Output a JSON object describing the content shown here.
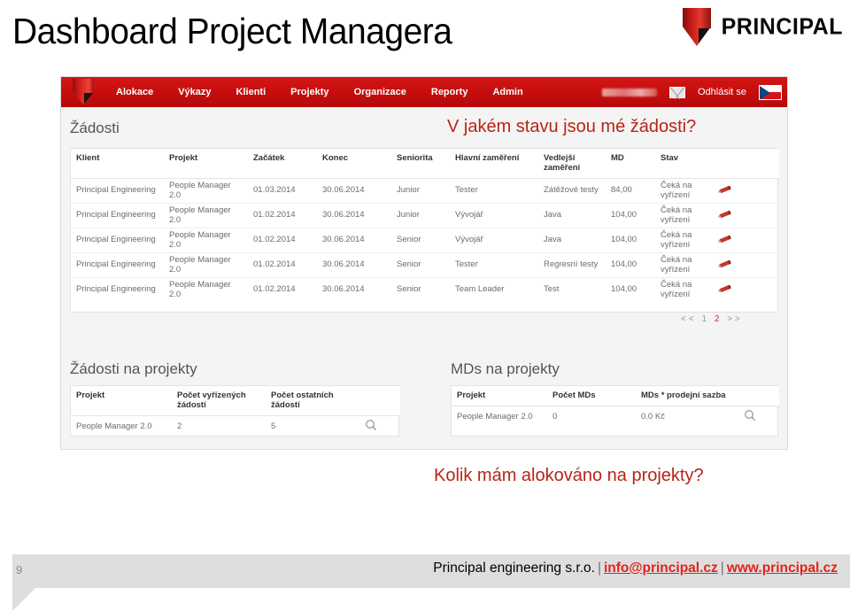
{
  "slide": {
    "title": "Dashboard Project Managera",
    "number": "9"
  },
  "brand": {
    "logo_word": "PRINCIPAL",
    "logo_icon": "principal-pennant-icon",
    "accent_red": "#c40d0d",
    "callout_red": "#b82418",
    "link_red": "#e2231a"
  },
  "app": {
    "navbar": {
      "logo_icon": "principal-pennant-icon",
      "items": [
        {
          "label": "Alokace"
        },
        {
          "label": "Výkazy"
        },
        {
          "label": "Klienti"
        },
        {
          "label": "Projekty"
        },
        {
          "label": "Organizace"
        },
        {
          "label": "Reporty"
        },
        {
          "label": "Admin"
        }
      ],
      "user_name": "",
      "mail_icon": "envelope-icon",
      "logout_label": "Odhlásit se",
      "flag_icon": "czech-flag-icon"
    },
    "requests": {
      "heading": "Žádosti",
      "columns": [
        "Klient",
        "Projekt",
        "Začátek",
        "Konec",
        "Seniorita",
        "Hlavní zaměření",
        "Vedlejší zaměření",
        "MD",
        "Stav",
        ""
      ],
      "rows": [
        {
          "klient": "Principal Engineering",
          "projekt": "People Manager 2.0",
          "zacatek": "01.03.2014",
          "konec": "30.06.2014",
          "seniorita": "Junior",
          "hlavni": "Tester",
          "vedlejsi": "Zátěžové testy",
          "md": "84,00",
          "stav": "Čeká na vyřízení",
          "action_icon": "edit-pencil-icon"
        },
        {
          "klient": "Principal Engineering",
          "projekt": "People Manager 2.0",
          "zacatek": "01.02.2014",
          "konec": "30.06.2014",
          "seniorita": "Junior",
          "hlavni": "Vývojář",
          "vedlejsi": "Java",
          "md": "104,00",
          "stav": "Čeká na vyřízení",
          "action_icon": "edit-pencil-icon"
        },
        {
          "klient": "Principal Engineering",
          "projekt": "People Manager 2.0",
          "zacatek": "01.02.2014",
          "konec": "30.06.2014",
          "seniorita": "Senior",
          "hlavni": "Vývojář",
          "vedlejsi": "Java",
          "md": "104,00",
          "stav": "Čeká na vyřízení",
          "action_icon": "edit-pencil-icon"
        },
        {
          "klient": "Principal Engineering",
          "projekt": "People Manager 2.0",
          "zacatek": "01.02.2014",
          "konec": "30.06.2014",
          "seniorita": "Senior",
          "hlavni": "Tester",
          "vedlejsi": "Regresní testy",
          "md": "104,00",
          "stav": "Čeká na vyřízení",
          "action_icon": "edit-pencil-icon"
        },
        {
          "klient": "Principal Engineering",
          "projekt": "People Manager 2.0",
          "zacatek": "01.02.2014",
          "konec": "30.06.2014",
          "seniorita": "Senior",
          "hlavni": "Team Leader",
          "vedlejsi": "Test",
          "md": "104,00",
          "stav": "Čeká na vyřízení",
          "action_icon": "edit-pencil-icon"
        }
      ],
      "pagination": {
        "first": "<<",
        "pages": [
          "1",
          "2"
        ],
        "current": "2",
        "last": ">>"
      }
    },
    "requests_by_project": {
      "heading": "Žádosti na projekty",
      "columns": [
        "Projekt",
        "Počet vyřízených žádostí",
        "Počet ostatních žádostí",
        ""
      ],
      "rows": [
        {
          "projekt": "People Manager 2.0",
          "vyrizenych": "2",
          "ostatnich": "5",
          "action_icon": "search-magnifier-icon"
        }
      ]
    },
    "mds_by_project": {
      "heading": "MDs na projekty",
      "columns": [
        "Projekt",
        "Počet MDs",
        "MDs * prodejní sazba",
        ""
      ],
      "rows": [
        {
          "projekt": "People Manager 2.0",
          "pocet_mds": "0",
          "mds_sazba": "0.0 Kč",
          "action_icon": "search-magnifier-icon"
        }
      ]
    }
  },
  "callouts": {
    "top": "V jakém stavu jsou mé žádosti?",
    "bottom": "Kolik mám alokováno na projekty?"
  },
  "footer": {
    "company": "Principal engineering s.r.o.",
    "separator": "|",
    "email": "info@principal.cz",
    "website": "www.principal.cz"
  }
}
